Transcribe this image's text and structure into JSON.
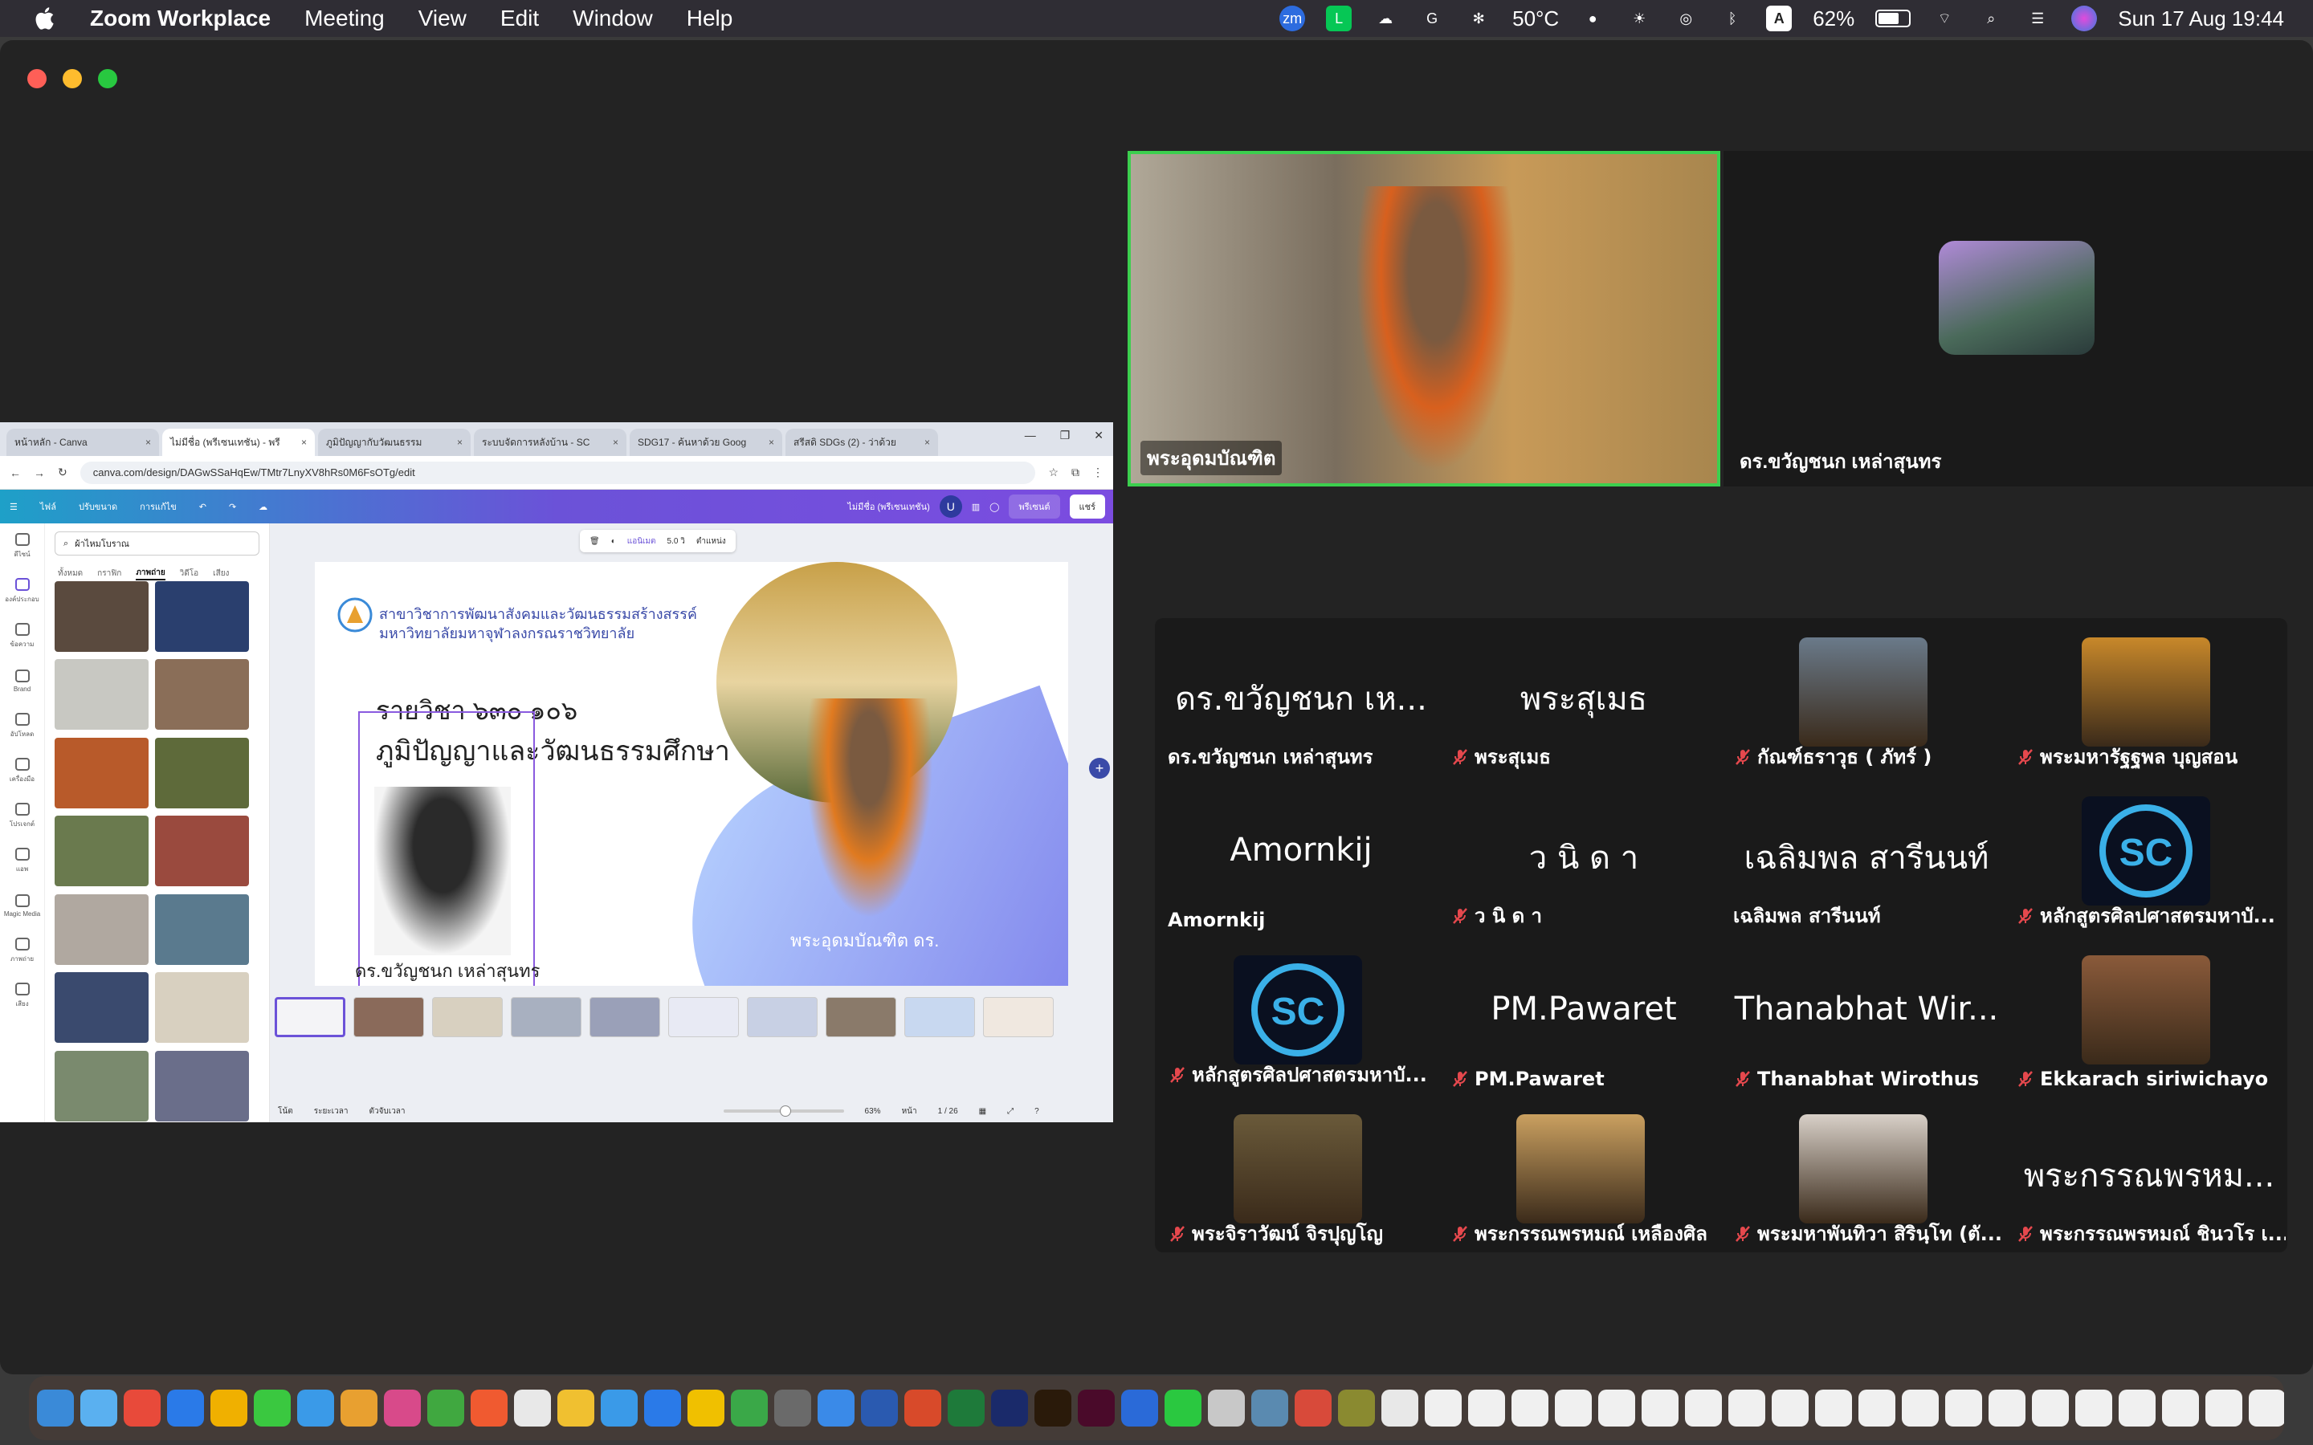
{
  "menubar": {
    "app_name": "Zoom Workplace",
    "menus": [
      "Meeting",
      "View",
      "Edit",
      "Window",
      "Help"
    ],
    "temperature": "50°C",
    "battery": "62%",
    "datetime": "Sun 17 Aug  19:44",
    "input_source": "A"
  },
  "browser": {
    "tabs": [
      {
        "label": "หน้าหลัก - Canva"
      },
      {
        "label": "ไม่มีชื่อ (พรีเซนเทชัน) - พรี"
      },
      {
        "label": "ภูมิปัญญากับวัฒนธรรม"
      },
      {
        "label": "ระบบจัดการหลังบ้าน - SC"
      },
      {
        "label": "SDG17 - ค้นหาด้วย Goog"
      },
      {
        "label": "สรีสดิ SDGs (2) - ว่าด้วย"
      }
    ],
    "url": "canva.com/design/DAGwSSaHqEw/TMtr7LnyXV8hRs0M6FsOTg/edit"
  },
  "canva": {
    "menu": [
      "ไฟล์",
      "ปรับขนาด",
      "การแก้ไข"
    ],
    "doc_title": "ไม่มีชื่อ (พรีเซนเทชัน)",
    "user_initial": "U",
    "present_label": "พรีเซนต์",
    "share_label": "แชร์",
    "rail": [
      "ดีไซน์",
      "องค์ประกอบ",
      "ข้อความ",
      "Brand",
      "อัปโหลด",
      "เครื่องมือ",
      "โปรเจกต์",
      "แอพ",
      "Magic Media",
      "ภาพถ่าย",
      "เสียง"
    ],
    "search_value": "ผ้าไหมโบราณ",
    "panel_tabs": [
      "ทั้งหมด",
      "กราฟิก",
      "ภาพถ่าย",
      "วิดีโอ",
      "เสียง"
    ],
    "toolbar": {
      "animate": "แอนิเมต",
      "duration": "5.0 วิ",
      "position": "ตำแหน่ง"
    },
    "slide": {
      "org_line1": "สาขาวิชาการพัฒนาสังคมและวัฒนธรรมสร้างสรรค์",
      "org_line2": "มหาวิทยาลัยมหาจุฬาลงกรณราชวิทยาลัย",
      "course": "รายวิชา ๖๓๐ ๑๐๖",
      "subject": "ภูมิปัญญาและวัฒนธรรมศึกษา",
      "left_person": "ดร.ขวัญชนก เหล่าสุนทร",
      "right_person": "พระอุดมบัณฑิต ดร."
    },
    "status": {
      "notes": "โน้ต",
      "duration": "ระยะเวลา",
      "timer": "ตัวจับเวลา",
      "zoom": "63%",
      "page": "1 / 26",
      "view": "หน้า"
    }
  },
  "top_tiles": [
    {
      "name": "พระอุดมบัณฑิต",
      "speaking": true
    },
    {
      "name": "ดร.ขวัญชนก เหล่าสุนทร",
      "speaking": false
    }
  ],
  "gallery": [
    {
      "big": "ดร.ขวัญชนก เห...",
      "label": "ดร.ขวัญชนก เหล่าสุนทร",
      "muted": false,
      "avatar": ""
    },
    {
      "big": "พระสุเมธ",
      "label": "พระสุเมธ",
      "muted": true,
      "avatar": ""
    },
    {
      "big": "",
      "label": "กัณฑ์ธราวุธ ( ภัทร์ )",
      "muted": true,
      "avatar": "#6a7a8a"
    },
    {
      "big": "",
      "label": "พระมหารัฐฐพล บุญสอน",
      "muted": true,
      "avatar": "#c8882a"
    },
    {
      "big": "Amornkij",
      "label": "Amornkij",
      "muted": false,
      "avatar": ""
    },
    {
      "big": "ว นิ ด า",
      "label": "ว นิ ด า",
      "muted": true,
      "avatar": ""
    },
    {
      "big": "เฉลิมพล สารีนนท์",
      "label": "เฉลิมพล สารีนนท์",
      "muted": false,
      "avatar": ""
    },
    {
      "big": "",
      "label": "หลักสูตรศิลปศาสตรมหาบั...",
      "muted": true,
      "avatar": "logo"
    },
    {
      "big": "",
      "label": "หลักสูตรศิลปศาสตรมหาบั...",
      "muted": true,
      "avatar": "logo"
    },
    {
      "big": "PM.Pawaret",
      "label": "PM.Pawaret",
      "muted": true,
      "avatar": ""
    },
    {
      "big": "Thanabhat Wir...",
      "label": "Thanabhat Wirothus",
      "muted": true,
      "avatar": ""
    },
    {
      "big": "",
      "label": "Ekkarach siriwichayo",
      "muted": true,
      "avatar": "#8a5a3a"
    },
    {
      "big": "",
      "label": "พระจิราวัฒน์ จิรปุญโญ",
      "muted": true,
      "avatar": "#6a5a3a"
    },
    {
      "big": "",
      "label": "พระกรรณพรหมณ์ เหลืองศิล",
      "muted": true,
      "avatar": "#caa060"
    },
    {
      "big": "",
      "label": "พระมหาพันทิวา สิรินฺโท (ตั...",
      "muted": true,
      "avatar": "#d8d0c8"
    },
    {
      "big": "พระกรรณพรหม...",
      "label": "พระกรรณพรหมณ์ ชินวโร  เ...",
      "muted": true,
      "avatar": ""
    }
  ]
}
